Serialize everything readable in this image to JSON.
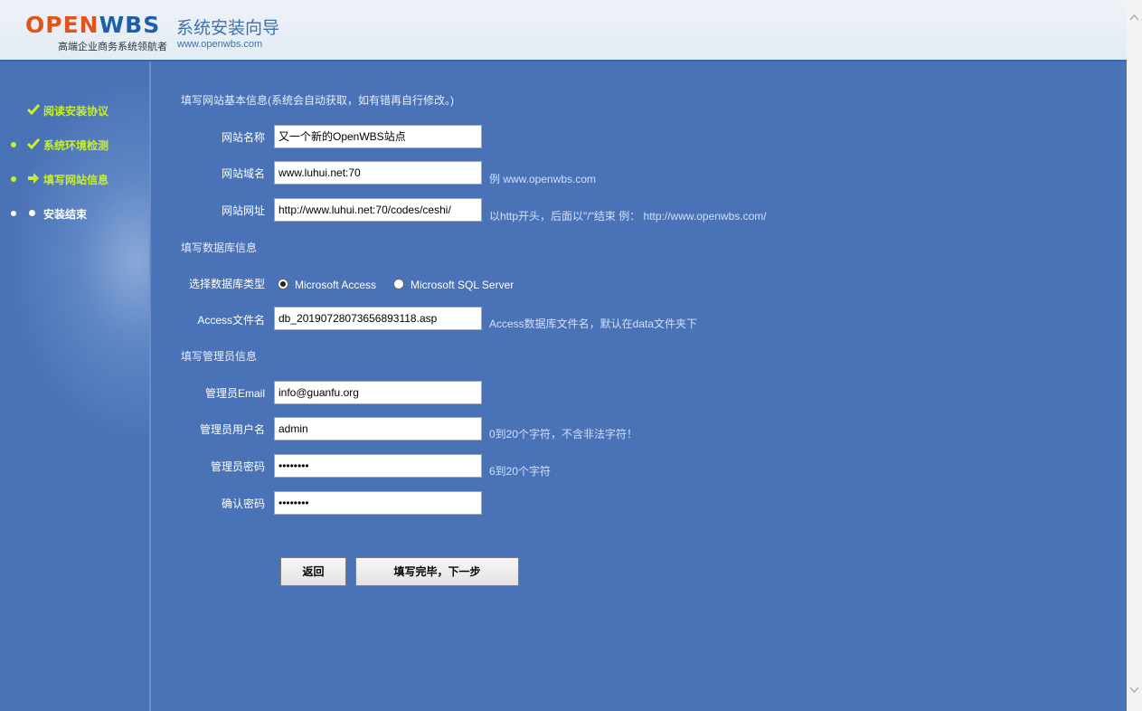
{
  "header": {
    "logo_part1": "OPEN",
    "logo_part2": "WBS",
    "slogan": "高端企业商务系统领航者",
    "title": "系统安装向导",
    "url": "www.openwbs.com"
  },
  "sidebar": {
    "steps": [
      {
        "label": "阅读安装协议",
        "icon": "check-icon",
        "state": "done"
      },
      {
        "label": "系统环境检测",
        "icon": "check-icon",
        "state": "done"
      },
      {
        "label": "填写网站信息",
        "icon": "arrow-right-icon",
        "state": "current"
      },
      {
        "label": "安装结束",
        "icon": "bullet-icon",
        "state": "pending"
      }
    ],
    "active_color": "#c8ef2c"
  },
  "site_info": {
    "section_title": "填写网站基本信息(系统会自动获取，如有错再自行修改。)",
    "name_label": "网站名称",
    "name_value": "又一个新的OpenWBS站点",
    "domain_label": "网站域名",
    "domain_value": "www.luhui.net:70",
    "domain_hint": "例 www.openwbs.com",
    "url_label": "网站网址",
    "url_value": "http://www.luhui.net:70/codes/ceshi/",
    "url_hint": "以http开头，后面以\"/\"结束 例： http://www.openwbs.com/"
  },
  "db_info": {
    "section_title": "填写数据库信息",
    "type_label": "选择数据库类型",
    "options": [
      "Microsoft Access",
      "Microsoft SQL Server"
    ],
    "selected": "Microsoft Access",
    "file_label": "Access文件名",
    "file_value": "db_20190728073656893118.asp",
    "file_hint": "Access数据库文件名，默认在data文件夹下"
  },
  "admin_info": {
    "section_title": "填写管理员信息",
    "email_label": "管理员Email",
    "email_value": "info@guanfu.org",
    "username_label": "管理员用户名",
    "username_value": "admin",
    "username_hint": "0到20个字符，不含非法字符！",
    "password_label": "管理员密码",
    "password_value": "••••••••",
    "password_hint": "6到20个字符",
    "confirm_label": "确认密码",
    "confirm_value": "••••••••"
  },
  "buttons": {
    "back": "返回",
    "next": "填写完毕，下一步"
  },
  "colors": {
    "background": "#4a72b6",
    "header_bg": "#e8eef6",
    "accent_green": "#c8ef2c",
    "logo_orange": "#e0541a",
    "logo_blue": "#1f5fa8"
  }
}
